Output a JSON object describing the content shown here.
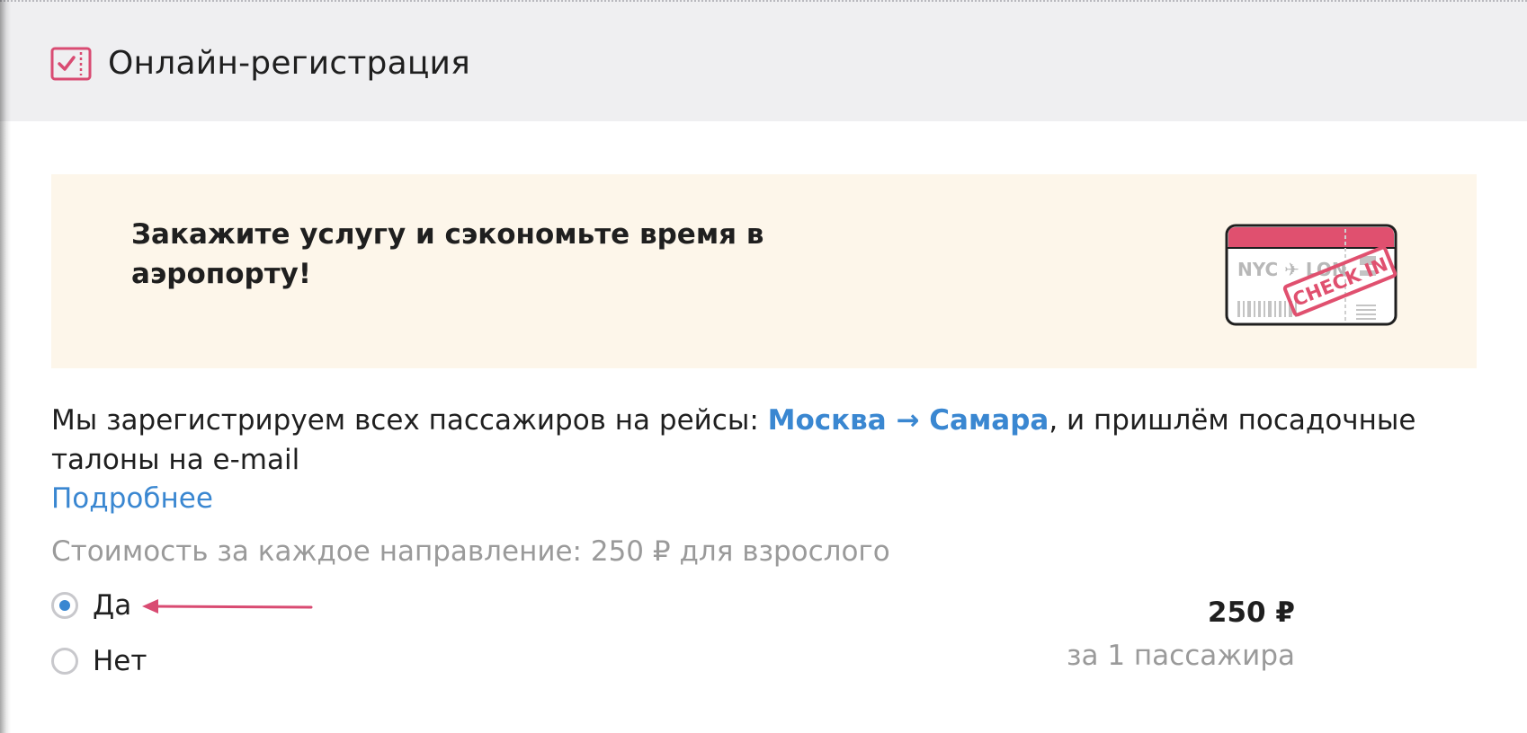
{
  "header": {
    "title": "Онлайн-регистрация",
    "icon": "checkin-ticket-icon",
    "accent_color": "#d94b72"
  },
  "promo": {
    "text": "Закажите услугу и сэкономьте время в аэропорту!",
    "illustration": "boarding-pass-check-in-icon",
    "ticket_text": {
      "route": "NYC ✈ LON",
      "stamp": "CHECK IN"
    }
  },
  "description": {
    "prefix": "Мы зарегистрируем всех пассажиров на рейсы: ",
    "route": "Москва → Самара",
    "suffix": ", и пришлём посадочные талоны на e-mail"
  },
  "more_link": "Подробнее",
  "cost_note": "Стоимость за каждое направление: 250 ₽ для взрослого",
  "options": [
    {
      "label": "Да",
      "selected": true
    },
    {
      "label": "Нет",
      "selected": false
    }
  ],
  "price": {
    "amount": "250 ₽",
    "per": "за 1 пассажира"
  },
  "colors": {
    "link": "#3a87d1",
    "accent": "#d94b72",
    "muted_text": "#9a9a9a",
    "promo_bg": "#fdf6ea",
    "header_bg": "#efeff1"
  }
}
